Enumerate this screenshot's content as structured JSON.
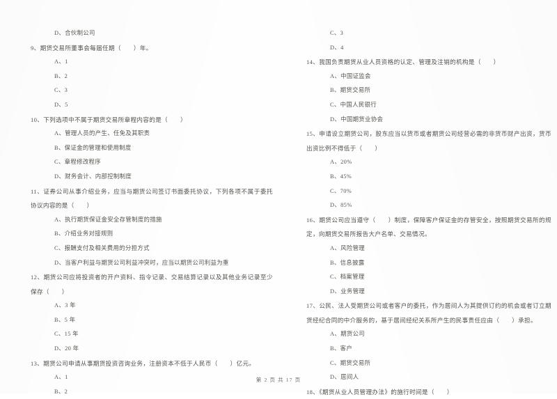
{
  "document": {
    "page_footer": "第 2 页 共 17 页",
    "page_number": "2",
    "total_pages": "17",
    "text_color": "#53534f",
    "background_color": "#fefefe"
  },
  "left_column": {
    "blocks": [
      {
        "kind": "option",
        "text": "D、合伙制公司"
      },
      {
        "kind": "question",
        "text": "9、期货交易所董事会每届任期（　　）年。"
      },
      {
        "kind": "option",
        "text": "A、1"
      },
      {
        "kind": "option",
        "text": "B、2"
      },
      {
        "kind": "option",
        "text": "C、3"
      },
      {
        "kind": "option",
        "text": "D、5"
      },
      {
        "kind": "question",
        "text": "10、下列选项中不属于期货交易所章程内容的是（　　）"
      },
      {
        "kind": "option",
        "text": "A、管理人员的产生、任免及其职责"
      },
      {
        "kind": "option",
        "text": "B、保证金的管理和使用制度"
      },
      {
        "kind": "option",
        "text": "C、章程修改程序"
      },
      {
        "kind": "option",
        "text": "D、财务会计、内部控制制度"
      },
      {
        "kind": "question",
        "text": "11、证券公司从事介绍业务，应当与期货公司签订书面委托协议，下列各项不属于委托协议内容的是（　　）"
      },
      {
        "kind": "option",
        "text": "A、执行期货保证金安全存管制度的措施"
      },
      {
        "kind": "option",
        "text": "B、介绍业务对接规则"
      },
      {
        "kind": "option",
        "text": "C、报酬支付及相关费用的分担方式"
      },
      {
        "kind": "option",
        "text": "D、当客户利益与期货公司利益冲突时，应当以期货公司利益为重"
      },
      {
        "kind": "question",
        "text": "12、期货公司应将投资者的开户资料、指令记录、交易结算记录以及其他业务记录至少保存（　　）"
      },
      {
        "kind": "option",
        "text": "A、3 年"
      },
      {
        "kind": "option",
        "text": "B、5 年"
      },
      {
        "kind": "option",
        "text": "C、15 年"
      },
      {
        "kind": "option",
        "text": "D、20 年"
      },
      {
        "kind": "question",
        "text": "13、期货公司申请从事期货投资咨询业务，注册资本不低于人民币（　　）亿元。"
      },
      {
        "kind": "option",
        "text": "A、1"
      },
      {
        "kind": "option",
        "text": "B、2"
      }
    ]
  },
  "right_column": {
    "blocks": [
      {
        "kind": "option",
        "text": "C、3"
      },
      {
        "kind": "option",
        "text": "D、4"
      },
      {
        "kind": "question",
        "text": "14、我国负责期货从业人员资格的认定、管理及注销的机构是（　　）"
      },
      {
        "kind": "option",
        "text": "A、中国证监会"
      },
      {
        "kind": "option",
        "text": "B、期货交易所"
      },
      {
        "kind": "option",
        "text": "C、中国人民银行"
      },
      {
        "kind": "option",
        "text": "D、中国期货业协会"
      },
      {
        "kind": "question",
        "text": "15、申请设立期货公司，股东应当以货币或者期货公司经营必需的非货币财产出资，货币出资比例不得低于（　　）"
      },
      {
        "kind": "option",
        "text": "A、20%"
      },
      {
        "kind": "option",
        "text": "B、45%"
      },
      {
        "kind": "option",
        "text": "C、70%"
      },
      {
        "kind": "option",
        "text": "D、85%"
      },
      {
        "kind": "question",
        "text": "16、期货公司应当遵守（　　）制度，保障客户保证金的存管安全，按照期货交易所的规定，向期货交易所报告大户名单、交易情况。"
      },
      {
        "kind": "option",
        "text": "A、风险管理"
      },
      {
        "kind": "option",
        "text": "B、信息披露"
      },
      {
        "kind": "option",
        "text": "C、档案管理"
      },
      {
        "kind": "option",
        "text": "D、业务管理"
      },
      {
        "kind": "question",
        "text": "17、公民、法人受期货公司或者客户的委托，作为居间人为其提供订约的机会或者订立期货经纪合同的中介服务的，基于居间经纪关系所产生的民事责任应由（　　）承担。"
      },
      {
        "kind": "option",
        "text": "A、期货公司"
      },
      {
        "kind": "option",
        "text": "B、客户"
      },
      {
        "kind": "option",
        "text": "C、期货交易所"
      },
      {
        "kind": "option",
        "text": "D、居间人"
      },
      {
        "kind": "question",
        "text": "18、《期货从业人员管理办法》的施行时间是（　　）"
      }
    ]
  }
}
